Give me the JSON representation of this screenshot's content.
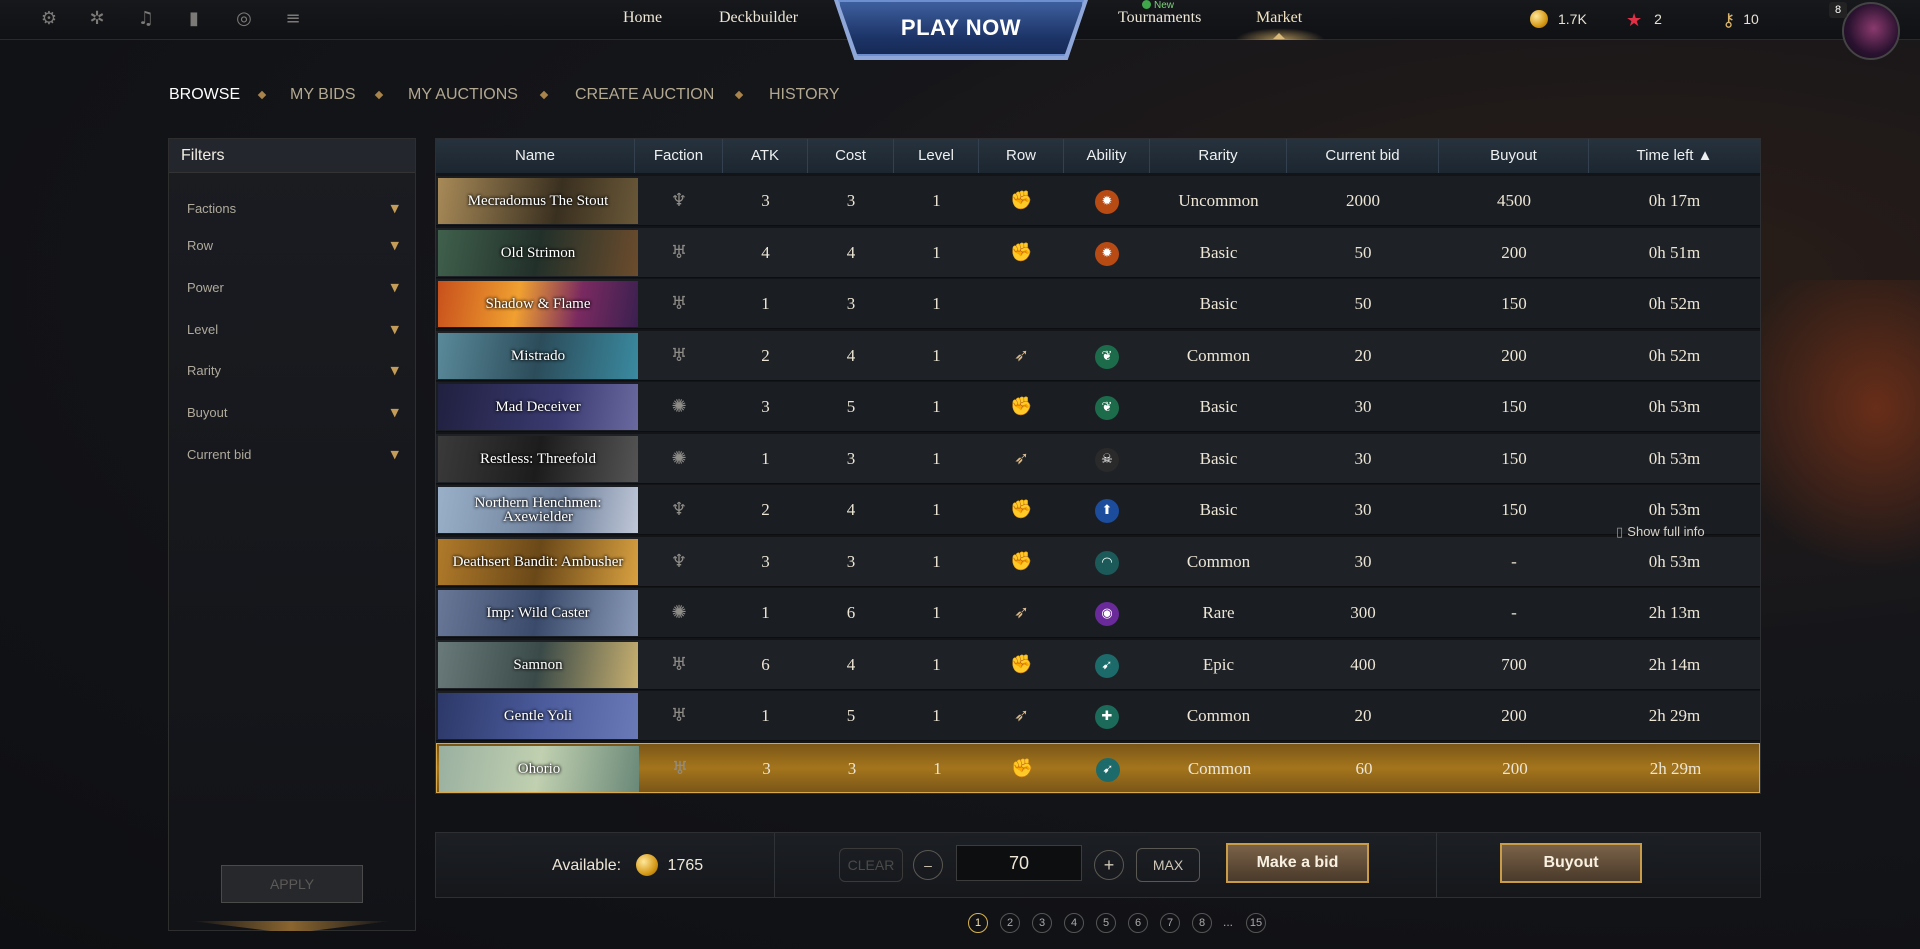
{
  "topbar": {
    "icons": [
      "gear-icon",
      "bug-icon",
      "bell-icon",
      "stats-icon",
      "coins-icon",
      "scroll-icon"
    ],
    "nav": {
      "home": "Home",
      "deckbuilder": "Deckbuilder",
      "play_now": "PLAY NOW",
      "tournaments": "Tournaments",
      "new_badge": "New",
      "market": "Market"
    },
    "resources": {
      "gold": "1.7K",
      "stars": "2",
      "keys": "10"
    },
    "avatar_level": "8"
  },
  "tabs": [
    "BROWSE",
    "MY BIDS",
    "MY AUCTIONS",
    "CREATE AUCTION",
    "HISTORY"
  ],
  "filters": {
    "title": "Filters",
    "items": [
      "Factions",
      "Row",
      "Power",
      "Level",
      "Rarity",
      "Buyout",
      "Current bid"
    ],
    "apply": "APPLY"
  },
  "table": {
    "columns": [
      "Name",
      "Faction",
      "ATK",
      "Cost",
      "Level",
      "Row",
      "Ability",
      "Rarity",
      "Current bid",
      "Buyout",
      "Time left ▲"
    ],
    "rows": [
      {
        "name": "Mecradomus The Stout",
        "faction": "faction-a",
        "atk": "3",
        "cost": "3",
        "level": "1",
        "row": "melee",
        "ability": "burst",
        "rarity": "Uncommon",
        "bid": "2000",
        "buyout": "4500",
        "time": "0h 17m"
      },
      {
        "name": "Old Strimon",
        "faction": "faction-b",
        "atk": "4",
        "cost": "4",
        "level": "1",
        "row": "melee",
        "ability": "burst",
        "rarity": "Basic",
        "bid": "50",
        "buyout": "200",
        "time": "0h 51m"
      },
      {
        "name": "Shadow & Flame",
        "faction": "faction-b",
        "atk": "1",
        "cost": "3",
        "level": "1",
        "row": "",
        "ability": "",
        "rarity": "Basic",
        "bid": "50",
        "buyout": "150",
        "time": "0h 52m"
      },
      {
        "name": "Mistrado",
        "faction": "faction-b",
        "atk": "2",
        "cost": "4",
        "level": "1",
        "row": "ranged",
        "ability": "leaf",
        "rarity": "Common",
        "bid": "20",
        "buyout": "200",
        "time": "0h 52m"
      },
      {
        "name": "Mad Deceiver",
        "faction": "faction-c",
        "atk": "3",
        "cost": "5",
        "level": "1",
        "row": "melee",
        "ability": "leaf",
        "rarity": "Basic",
        "bid": "30",
        "buyout": "150",
        "time": "0h 53m"
      },
      {
        "name": "Restless: Threefold",
        "faction": "faction-c",
        "atk": "1",
        "cost": "3",
        "level": "1",
        "row": "ranged",
        "ability": "skull",
        "rarity": "Basic",
        "bid": "30",
        "buyout": "150",
        "time": "0h 53m"
      },
      {
        "name": "Northern Henchmen: Axewielder",
        "faction": "faction-a",
        "atk": "2",
        "cost": "4",
        "level": "1",
        "row": "melee",
        "ability": "arrow-up",
        "rarity": "Basic",
        "bid": "30",
        "buyout": "150",
        "time": "0h 53m"
      },
      {
        "name": "Deathsert Bandit: Ambusher",
        "faction": "faction-a",
        "atk": "3",
        "cost": "3",
        "level": "1",
        "row": "melee",
        "ability": "shield",
        "rarity": "Common",
        "bid": "30",
        "buyout": "-",
        "time": "0h 53m"
      },
      {
        "name": "Imp: Wild Caster",
        "faction": "faction-c",
        "atk": "1",
        "cost": "6",
        "level": "1",
        "row": "ranged",
        "ability": "swirl",
        "rarity": "Rare",
        "bid": "300",
        "buyout": "-",
        "time": "2h 13m"
      },
      {
        "name": "Samnon",
        "faction": "faction-b",
        "atk": "6",
        "cost": "4",
        "level": "1",
        "row": "melee",
        "ability": "wing",
        "rarity": "Epic",
        "bid": "400",
        "buyout": "700",
        "time": "2h 14m"
      },
      {
        "name": "Gentle Yoli",
        "faction": "faction-b",
        "atk": "1",
        "cost": "5",
        "level": "1",
        "row": "ranged",
        "ability": "heal",
        "rarity": "Common",
        "bid": "20",
        "buyout": "200",
        "time": "2h 29m"
      },
      {
        "name": "Ohorio",
        "faction": "faction-b",
        "atk": "3",
        "cost": "3",
        "level": "1",
        "row": "melee",
        "ability": "wing",
        "rarity": "Common",
        "bid": "60",
        "buyout": "200",
        "time": "2h 29m"
      }
    ],
    "show_full_info": "Show full info"
  },
  "bid_bar": {
    "available_label": "Available:",
    "available_value": "1765",
    "clear": "CLEAR",
    "minus": "–",
    "bid_value": "70",
    "plus": "+",
    "max": "MAX",
    "make_bid": "Make a bid",
    "buyout": "Buyout"
  },
  "pagination": {
    "pages": [
      "1",
      "2",
      "3",
      "4",
      "5",
      "6",
      "7",
      "8",
      "...",
      "15"
    ],
    "current": "1"
  },
  "colors": {
    "accent_gold": "#c89c48",
    "header_blue": "#1c2630",
    "selected_row": "#a4751c",
    "playnow_blue": "#1c3366"
  }
}
